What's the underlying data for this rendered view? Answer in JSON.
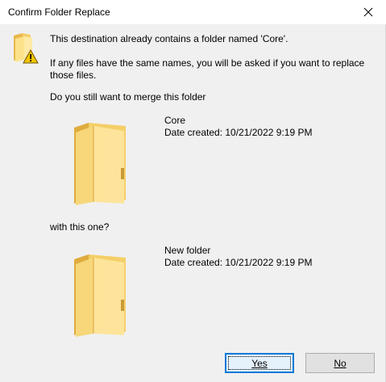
{
  "window": {
    "title": "Confirm Folder Replace",
    "close_icon": "close-icon"
  },
  "message": {
    "line1": "This destination already contains a folder named 'Core'.",
    "line2": "If any files have the same names, you will be asked if you want to replace those files.",
    "line3": "Do you still want to merge this folder",
    "line4": "with this one?"
  },
  "source_folder": {
    "name": "Core",
    "date_created": "Date created: 10/21/2022 9:19 PM"
  },
  "target_folder": {
    "name": "New folder",
    "date_created": "Date created: 10/21/2022 9:19 PM"
  },
  "buttons": {
    "yes_label": "Yes",
    "no_label": "No"
  },
  "colors": {
    "accent": "#0078d7",
    "folder_front": "#ffe08a",
    "folder_back": "#e8b84c",
    "warning": "#f5c400"
  }
}
